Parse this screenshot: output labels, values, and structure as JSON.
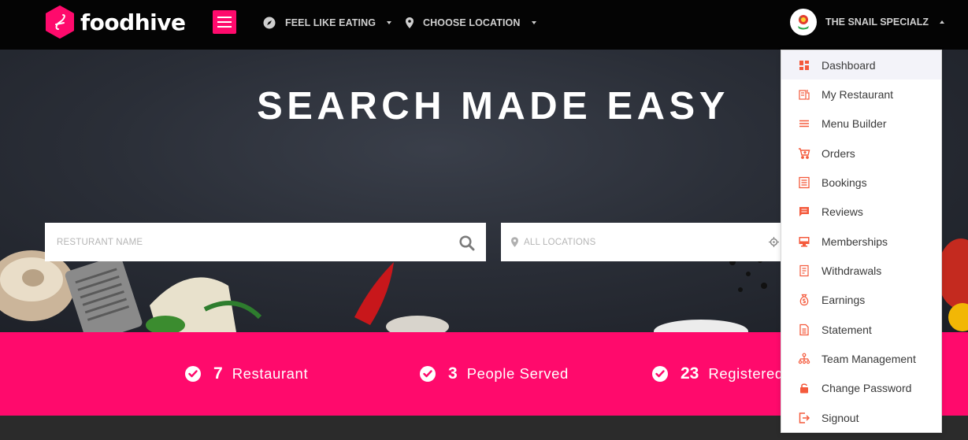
{
  "brand": {
    "name": "foodhive"
  },
  "nav": {
    "feel_like_eating": "FEEL LIKE EATING",
    "choose_location": "CHOOSE LOCATION"
  },
  "user": {
    "name": "THE SNAIL SPECIALZ"
  },
  "hero": {
    "title": "SEARCH MADE EASY",
    "restaurant_placeholder": "RESTURANT NAME",
    "location_placeholder": "ALL LOCATIONS"
  },
  "stats": [
    {
      "value": "7",
      "label": "Restaurant"
    },
    {
      "value": "3",
      "label": "People Served"
    },
    {
      "value": "23",
      "label": "Registered Users"
    }
  ],
  "dropdown": {
    "items": [
      {
        "label": "Dashboard",
        "icon": "dashboard-icon"
      },
      {
        "label": "My Restaurant",
        "icon": "restaurant-icon"
      },
      {
        "label": "Menu Builder",
        "icon": "menu-lines-icon"
      },
      {
        "label": "Orders",
        "icon": "cart-icon"
      },
      {
        "label": "Bookings",
        "icon": "list-icon"
      },
      {
        "label": "Reviews",
        "icon": "comment-icon"
      },
      {
        "label": "Memberships",
        "icon": "monitor-icon"
      },
      {
        "label": "Withdrawals",
        "icon": "receipt-icon"
      },
      {
        "label": "Earnings",
        "icon": "money-bag-icon"
      },
      {
        "label": "Statement",
        "icon": "document-icon"
      },
      {
        "label": "Team Management",
        "icon": "team-icon"
      },
      {
        "label": "Change Password",
        "icon": "lock-icon"
      },
      {
        "label": "Signout",
        "icon": "signout-icon"
      }
    ]
  },
  "colors": {
    "accent": "#ff0a6c",
    "icon": "#f45a3c",
    "navbar": "#040404"
  }
}
